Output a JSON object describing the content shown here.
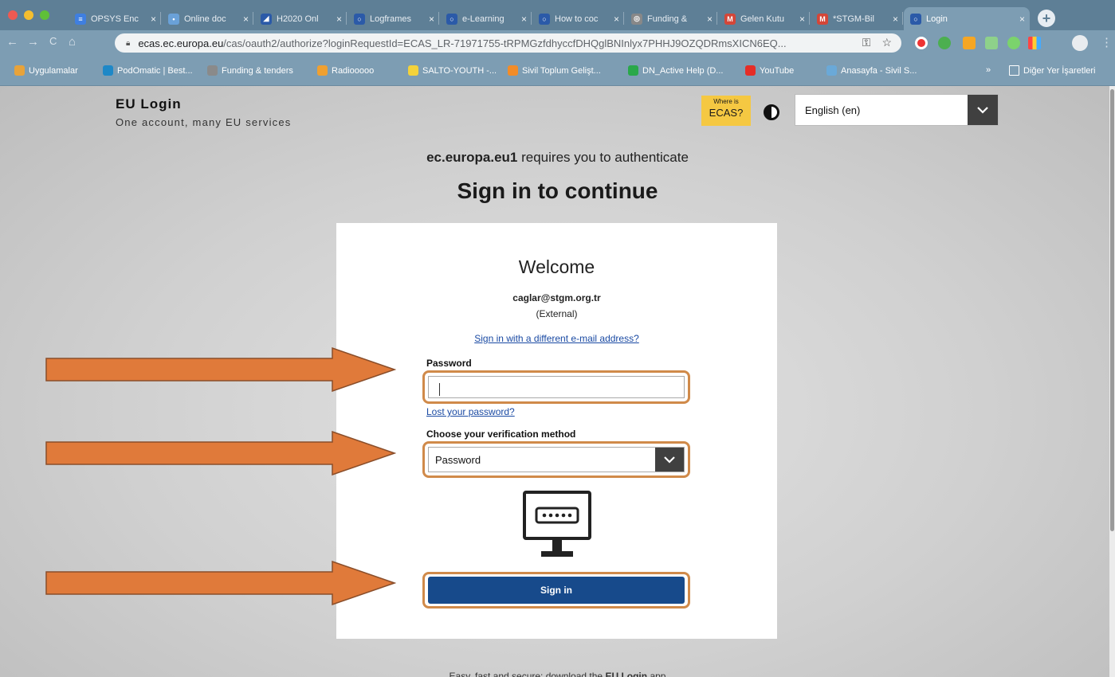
{
  "browser": {
    "tabs": [
      {
        "label": "OPSYS Enc",
        "color": "#3f7fe0",
        "glyph": "≡"
      },
      {
        "label": "Online doc",
        "color": "#6aa1d8",
        "glyph": "•"
      },
      {
        "label": "H2020 Onl",
        "color": "#2b5aa8",
        "glyph": "◢"
      },
      {
        "label": "Logframes",
        "color": "#2b5aa8",
        "glyph": "○"
      },
      {
        "label": "e-Learning",
        "color": "#2b5aa8",
        "glyph": "○"
      },
      {
        "label": "How to coc",
        "color": "#2b5aa8",
        "glyph": "○"
      },
      {
        "label": "Funding &",
        "color": "#888888",
        "glyph": "◎"
      },
      {
        "label": "Gelen Kutu",
        "color": "#d44638",
        "glyph": "M"
      },
      {
        "label": "*STGM-Bil",
        "color": "#d44638",
        "glyph": "M"
      },
      {
        "label": "Login",
        "color": "#2b5aa8",
        "glyph": "○"
      }
    ],
    "tab_close": "×",
    "new_tab": "+",
    "url_host": "ecas.ec.europa.eu",
    "url_path": "/cas/oauth2/authorize?loginRequestId=ECAS_LR-71971755-tRPMGzfdhyccfDHQglBNInlyx7PHHJ9OZQDRmsXICN6EQ...",
    "nav": {
      "back": "←",
      "forward": "→",
      "reload": "C",
      "home": "⌂"
    },
    "bookmarks": [
      {
        "label": "Uygulamalar",
        "color": "#e8a33a"
      },
      {
        "label": "PodOmatic | Best...",
        "color": "#1e88c7"
      },
      {
        "label": "Funding & tenders",
        "color": "#8a8a8a"
      },
      {
        "label": "Radiooooo",
        "color": "#f0a030"
      },
      {
        "label": "SALTO-YOUTH -...",
        "color": "#f3d23b"
      },
      {
        "label": "Sivil Toplum Gelişt...",
        "color": "#f28c28"
      },
      {
        "label": "DN_Active Help (D...",
        "color": "#2aa84a"
      },
      {
        "label": "YouTube",
        "color": "#e52d27"
      },
      {
        "label": "Anasayfa - Sivil S...",
        "color": "#6aa9d8"
      }
    ],
    "bookmarks_more": "»",
    "other_bookmarks": "Diğer Yer İşaretleri"
  },
  "header": {
    "title": "EU Login",
    "subtitle": "One account, many EU services",
    "where_small": "Where is",
    "where_big": "ECAS?",
    "language": "English (en)"
  },
  "auth": {
    "service": "ec.europa.eu1",
    "requires_text": " requires you to authenticate",
    "heading": "Sign in to continue"
  },
  "card": {
    "welcome": "Welcome",
    "email": "caglar@stgm.org.tr",
    "account_type": "(External)",
    "different_email_link": "Sign in with a different e-mail address?",
    "password_label": "Password",
    "password_value": "",
    "lost_password_link": "Lost your password?",
    "method_label": "Choose your verification method",
    "method_value": "Password",
    "signin_button": "Sign in"
  },
  "footer": {
    "note_start": "Easy, fast and secure: download the ",
    "note_bold": "EU Login",
    "note_end": " app"
  },
  "colors": {
    "arrow": "#e07a3a",
    "highlight_border": "#d08a4a",
    "signin_blue": "#174a8b",
    "ecas_yellow": "#f5c842"
  }
}
